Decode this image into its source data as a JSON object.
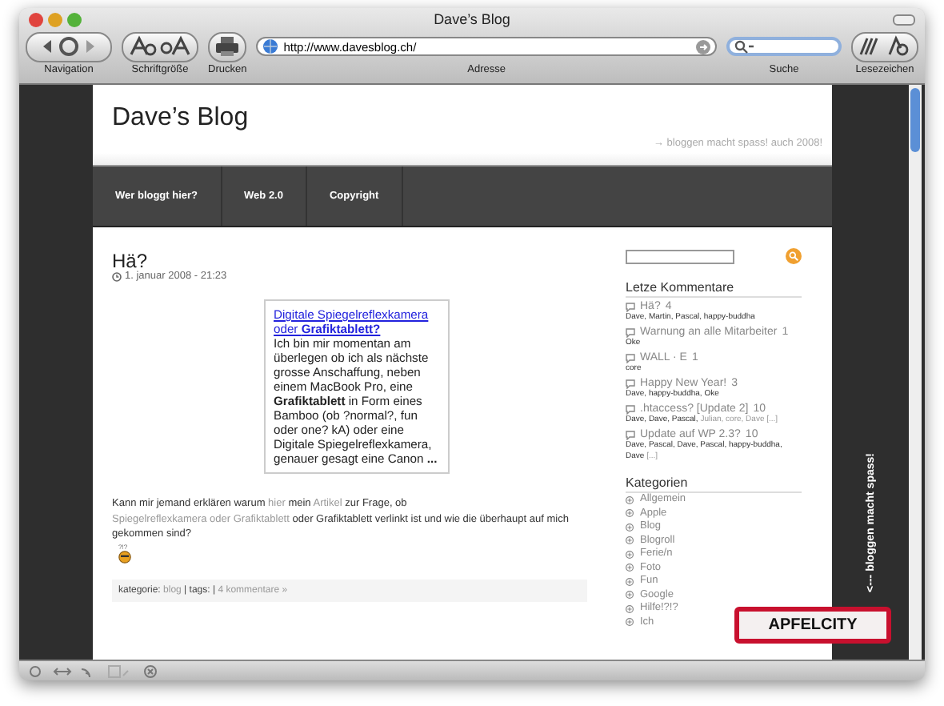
{
  "window": {
    "title": "Dave’s Blog"
  },
  "toolbar": {
    "groups": [
      {
        "kind": "nav",
        "label": "Navigation"
      },
      {
        "kind": "font",
        "label": "Schriftgröße"
      },
      {
        "kind": "print",
        "label": "Drucken"
      }
    ],
    "address": {
      "value": "http://www.davesblog.ch/",
      "label": "Adresse"
    },
    "search": {
      "label": "Suche"
    },
    "bookmarks": {
      "label": "Lesezeichen"
    }
  },
  "blog": {
    "title": "Dave’s Blog",
    "tagline": "→ bloggen macht spass! auch 2008!",
    "nav": [
      "Wer bloggt hier?",
      "Web 2.0",
      "Copyright"
    ],
    "post": {
      "title": "Hä?",
      "date": "1. januar 2008 - 21:23",
      "quote": {
        "link": "Digitale Spiegelreflexkamera oder **Grafiktablett?**",
        "text": "Ich bin mir momentan am überlegen ob ich als nächste grosse Anschaffung, neben einem MacBook Pro, eine **Grafiktablett** in Form eines Bamboo (ob ?normal?, fun oder one? kA) oder eine Digitale Spiegelreflexkamera, genauer gesagt eine Canon **...**"
      },
      "body": [
        {
          "text": "Kann mir jemand erklären warum",
          "link": false
        },
        {
          "text": "hier",
          "link": true
        },
        {
          "text": "mein",
          "link": false
        },
        {
          "text": "Artikel",
          "link": true
        },
        {
          "text": "zur Frage, ob",
          "link": false
        },
        {
          "text": "Spiegelreflexkamera oder Grafiktablett",
          "link": true
        },
        {
          "text": "oder Grafiktablett verlinkt ist und wie die überhaupt auf mich gekommen sind?",
          "link": false
        }
      ],
      "smiley_text": "?!?",
      "footer": [
        {
          "text": "kategorie:",
          "link": false
        },
        {
          "text": "blog",
          "link": true
        },
        {
          "text": "| tags: |",
          "link": false
        },
        {
          "text": "4 kommentare »",
          "link": true
        }
      ]
    },
    "side_text": "<--- bloggen macht spass!",
    "sign": "APFELCITY"
  },
  "sidebar": {
    "comments_title": "Letze Kommentare",
    "comments": [
      {
        "title": "Hä?",
        "count": "4",
        "authors": [
          {
            "name": "Dave, Martin, Pascal, happy-buddha",
            "link": false
          }
        ]
      },
      {
        "title": "Warnung an alle Mitarbeiter",
        "count": "1",
        "authors": [
          {
            "name": "Oke",
            "link": false
          }
        ]
      },
      {
        "title": "WALL · E",
        "count": "1",
        "authors": [
          {
            "name": "core",
            "link": false
          }
        ]
      },
      {
        "title": "Happy New Year!",
        "count": "3",
        "authors": [
          {
            "name": "Dave, happy-buddha, Oke",
            "link": false
          }
        ]
      },
      {
        "title": ".htaccess? [Update 2]",
        "count": "10",
        "authors": [
          {
            "name": "Dave, Dave, Pascal,",
            "link": false
          },
          {
            "name": "Julian, core, Dave [...]",
            "link": true
          }
        ]
      },
      {
        "title": "Update auf WP 2.3?",
        "count": "10",
        "authors": [
          {
            "name": "Dave, Pascal, Dave, Pascal, happy-buddha, Dave",
            "link": false
          },
          {
            "name": "[...]",
            "link": true
          }
        ]
      }
    ],
    "categories_title": "Kategorien",
    "categories": [
      "Allgemein",
      "Apple",
      "Blog",
      "Blogroll",
      "Ferie/n",
      "Foto",
      "Fun",
      "Google",
      "Hilfe!?!?",
      "Ich"
    ]
  }
}
